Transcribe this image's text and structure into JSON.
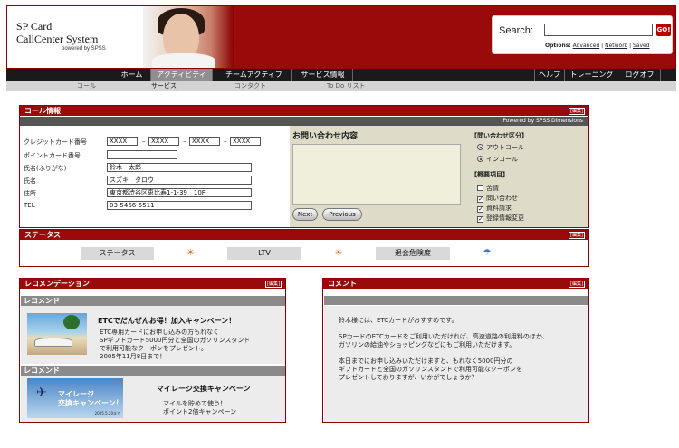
{
  "header": {
    "title_line1": "SP Card",
    "title_line2": "CallCenter System",
    "powered": "powered by SPSS",
    "search_label": "Search:",
    "search_value": "",
    "go_label": "GO!",
    "options_label": "Options:",
    "opt_advanced": "Advanced",
    "opt_network": "Network",
    "opt_saved": "Saved"
  },
  "nav": {
    "main": [
      "ホーム",
      "アクティビティ",
      "チームアクティブ",
      "サービス情報"
    ],
    "right": [
      "ヘルプ",
      "トレーニング",
      "ログオフ"
    ],
    "active_index": 1,
    "sub": [
      "コール",
      "サービス",
      "コンタクト",
      "To Do リスト"
    ],
    "sub_active_index": 1
  },
  "edit_label": "[編集]",
  "callinfo": {
    "title": "コール情報",
    "powered": "Powered by SPSS Dimensions",
    "card_label": "クレジットカード番号",
    "card_parts": [
      "XXXX",
      "XXXX",
      "XXXX",
      "XXXX"
    ],
    "dash": "–",
    "point_label": "ポイントカード番号",
    "point_value": "",
    "kana_label": "氏名(ふりがな)",
    "kana_value": "鈴木　太郎",
    "name_label": "氏名",
    "name_value": "スズキ　タロウ",
    "addr_label": "住所",
    "addr_value": "東京都渋谷区恵比寿1-1-39　10F",
    "tel_label": "TEL",
    "tel_value": "03-5466-5511",
    "inquiry_title": "お問い合わせ内容",
    "inquiry_value": "",
    "next_label": "Next",
    "previous_label": "Previous",
    "category_title": "【問い合わせ区分】",
    "radio_out": "アウトコール",
    "radio_in": "インコール",
    "summary_title": "【概要項目】",
    "checks": [
      {
        "label": "苦情",
        "checked": false
      },
      {
        "label": "問い合わせ",
        "checked": true
      },
      {
        "label": "資料請求",
        "checked": true
      },
      {
        "label": "登録情報変更",
        "checked": true
      }
    ]
  },
  "status": {
    "title": "ステータス",
    "label_status": "ステータス",
    "label_ltv": "LTV",
    "label_risk": "退会危険度",
    "icon_status": "sun-icon",
    "icon_ltv": "sun-icon",
    "icon_risk": "umbrella-icon",
    "colors": {
      "sun": "#e87000",
      "umbrella": "#3a79c4"
    }
  },
  "recommend": {
    "title": "レコメンデーション",
    "sub1": "レコメンド",
    "item1_title": "ETCでだんぜんお得！加入キャンペーン！",
    "item1_text": "ETC専用カードにお申し込みの方もれなく\nSPギフトカード5000円分と全国のガソリンスタンド\nで利用可能なクーポンをプレゼント。\n2005年11月8日まで！",
    "sub2": "レコメンド",
    "item2_title": "マイレージ交換キャンペーン",
    "item2_img_text": "マイレージ\n交換キャンペーン！",
    "item2_img_date": "2005.5.20まで",
    "item2_text": "マイルを貯めて使う！\nポイント2倍キャンペーン"
  },
  "comment": {
    "title": "コメント",
    "text": "鈴木様には、ETCカードがおすすめです。\n\nSPカードのETCカードをご利用いただければ、高速道路の利用料のほか、\nガソリンの給油やショッピングなどにもご利用いただけます。\n\n本日までにお申し込みいただけますと、もれなく5000円分の\nギフトカードと全国のガソリンスタンドで利用可能なクーポンを\nプレゼントしておりますが、いかがでしょうか？"
  },
  "colors": {
    "brand": "#9b0a0a",
    "nav": "#1a1a1a",
    "panel_gray": "#8a8a8a"
  }
}
